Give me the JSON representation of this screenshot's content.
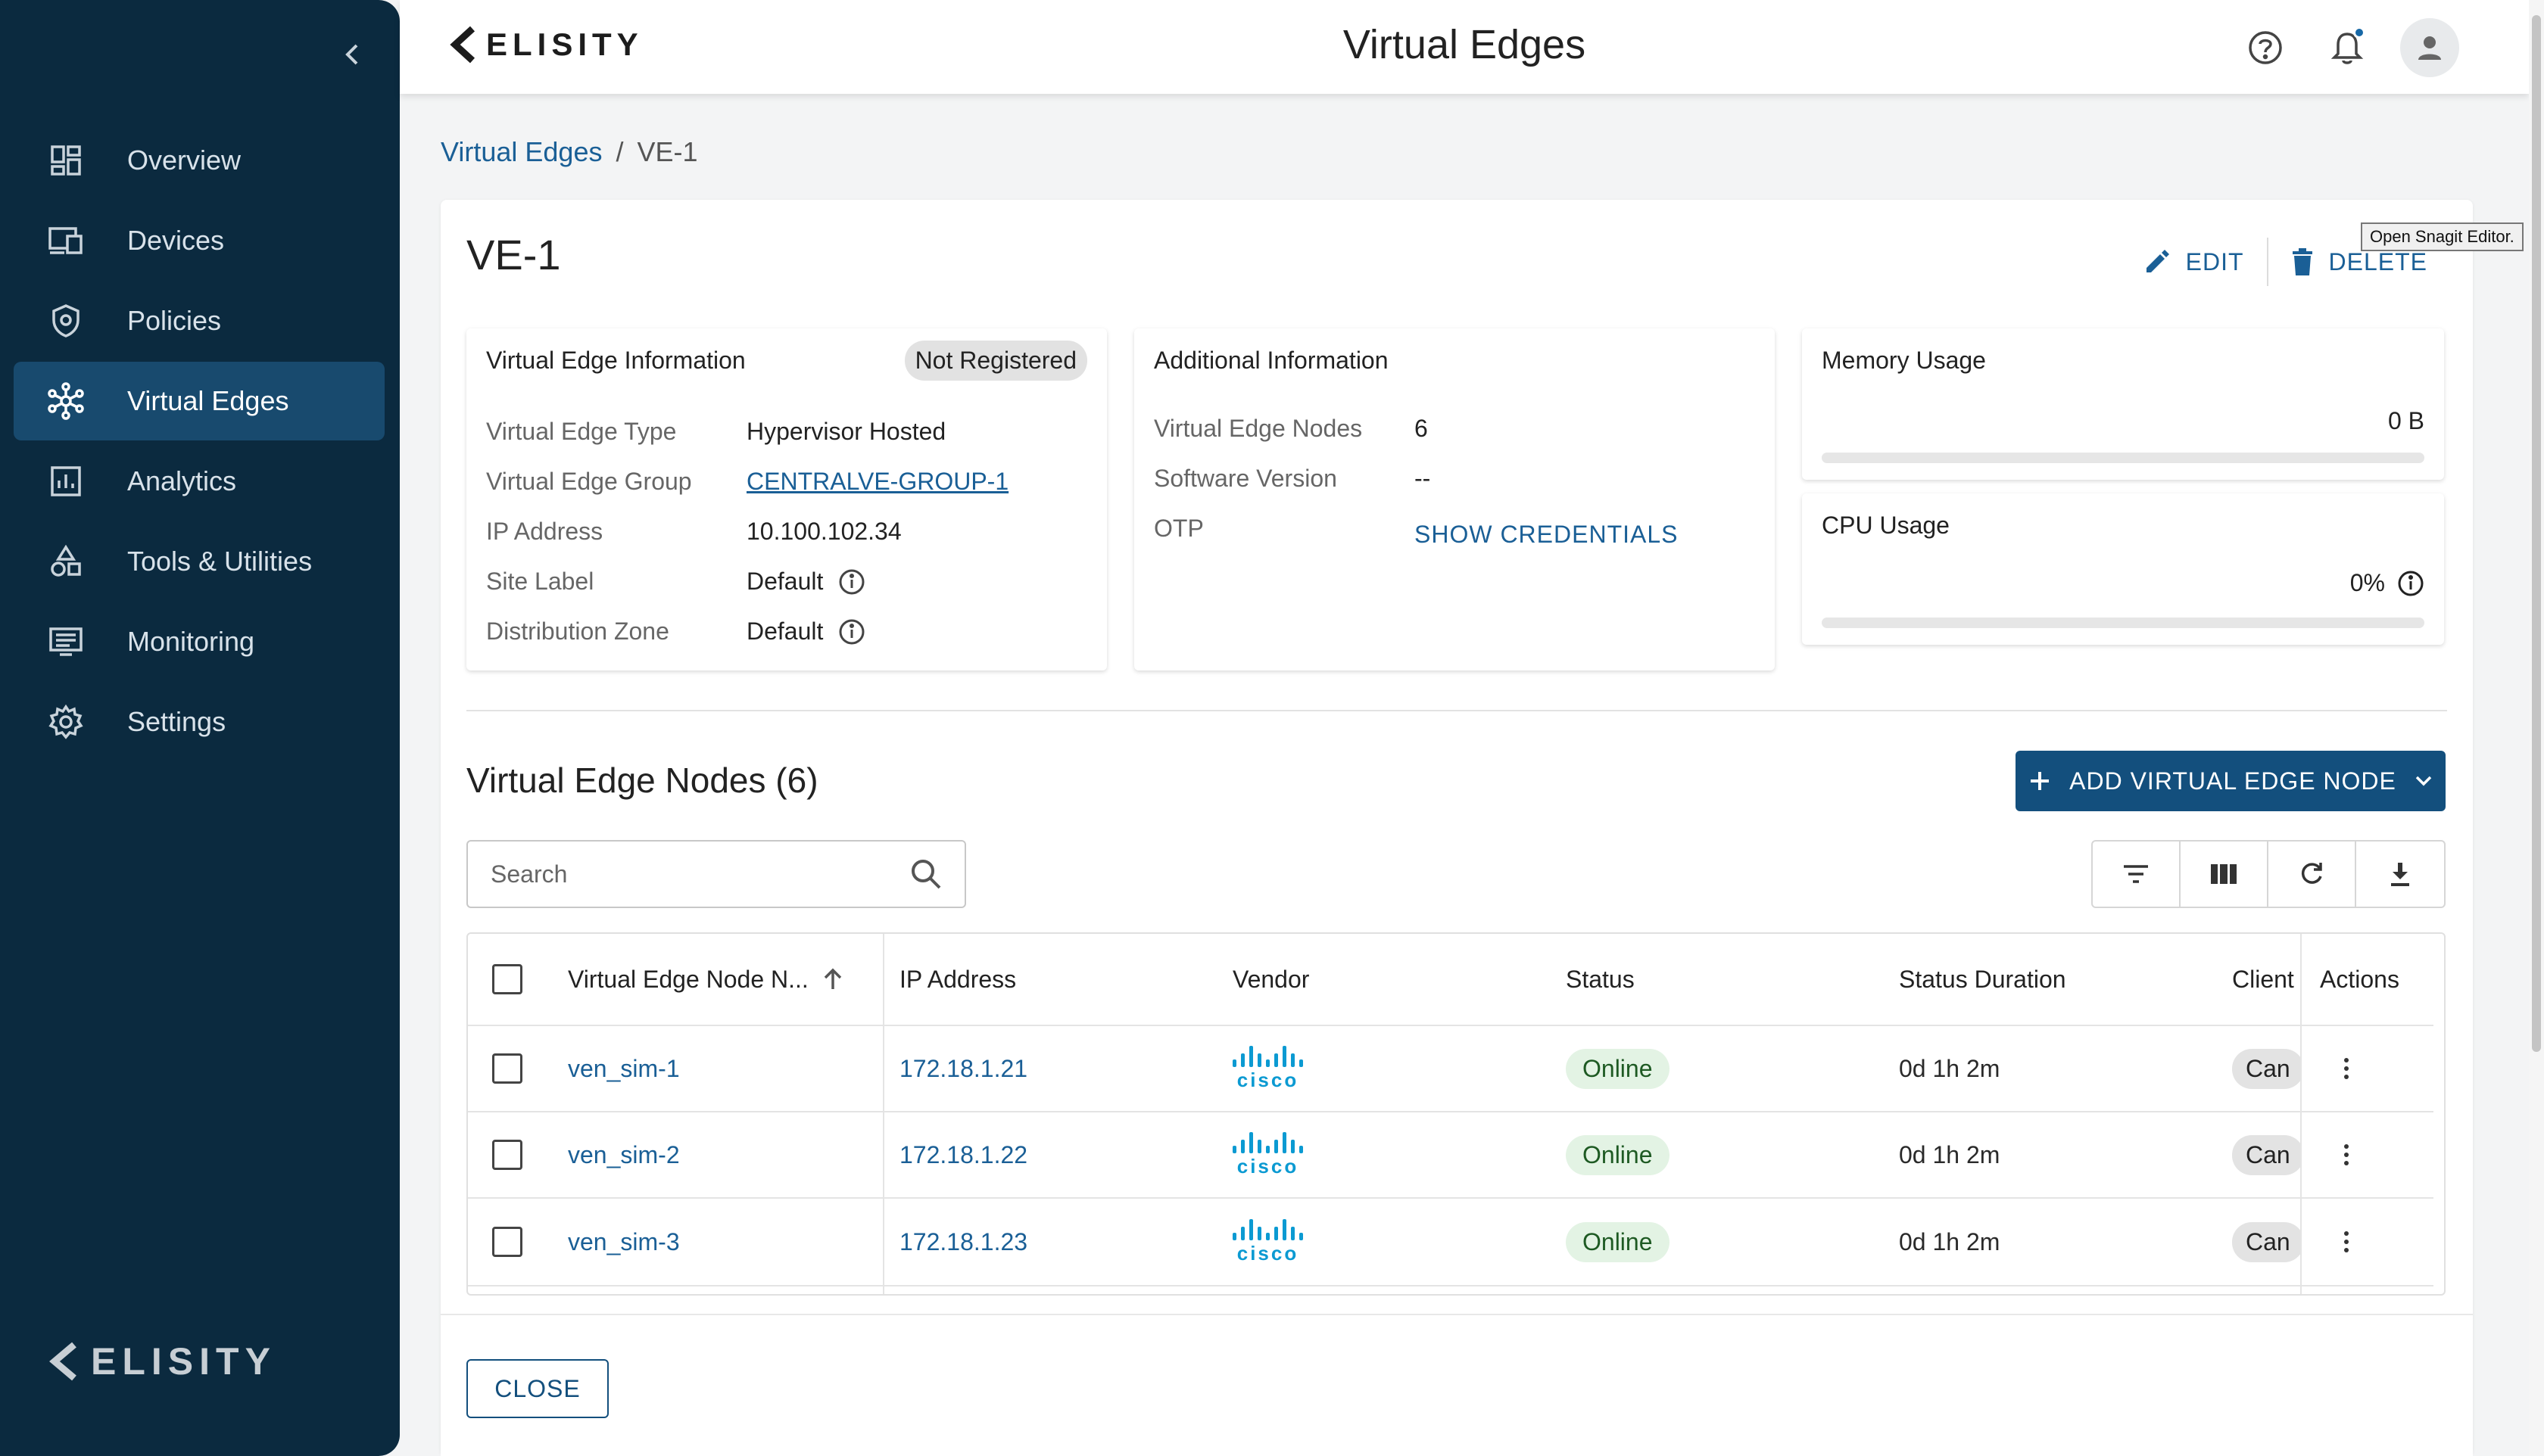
{
  "sidebar": {
    "items": [
      {
        "label": "Overview",
        "icon": "dashboard-icon"
      },
      {
        "label": "Devices",
        "icon": "devices-icon"
      },
      {
        "label": "Policies",
        "icon": "shield-icon"
      },
      {
        "label": "Virtual Edges",
        "icon": "network-icon"
      },
      {
        "label": "Analytics",
        "icon": "analytics-icon"
      },
      {
        "label": "Tools & Utilities",
        "icon": "tools-icon"
      },
      {
        "label": "Monitoring",
        "icon": "monitor-icon"
      },
      {
        "label": "Settings",
        "icon": "gear-icon"
      }
    ],
    "active": "Virtual Edges",
    "logo": "ELISITY"
  },
  "header": {
    "logo": "ELISITY",
    "title": "Virtual Edges"
  },
  "breadcrumb": {
    "parent": "Virtual Edges",
    "separator": "/",
    "current": "VE-1"
  },
  "card": {
    "title": "VE-1",
    "edit_label": "EDIT",
    "delete_label": "DELETE",
    "tooltip": "Open Snagit Editor."
  },
  "ve_info": {
    "title": "Virtual Edge Information",
    "status": "Not Registered",
    "rows": [
      {
        "label": "Virtual Edge Type",
        "value": "Hypervisor Hosted"
      },
      {
        "label": "Virtual Edge Group",
        "value": "CENTRALVE-GROUP-1"
      },
      {
        "label": "IP Address",
        "value": "10.100.102.34"
      },
      {
        "label": "Site Label",
        "value": "Default"
      },
      {
        "label": "Distribution Zone",
        "value": "Default"
      }
    ]
  },
  "additional_info": {
    "title": "Additional Information",
    "rows": [
      {
        "label": "Virtual Edge Nodes",
        "value": "6"
      },
      {
        "label": "Software Version",
        "value": "--"
      },
      {
        "label": "OTP",
        "value": "SHOW CREDENTIALS"
      }
    ]
  },
  "memory": {
    "title": "Memory Usage",
    "value": "0 B"
  },
  "cpu": {
    "title": "CPU Usage",
    "value": "0%"
  },
  "nodes": {
    "title": "Virtual Edge Nodes (6)",
    "add_label": "ADD VIRTUAL EDGE NODE",
    "search_placeholder": "Search",
    "columns": {
      "name": "Virtual Edge Node N...",
      "ip": "IP Address",
      "vendor": "Vendor",
      "status": "Status",
      "duration": "Status Duration",
      "client": "Client",
      "actions": "Actions"
    },
    "rows": [
      {
        "name": "ven_sim-1",
        "ip": "172.18.1.21",
        "vendor": "cisco",
        "status": "Online",
        "duration": "0d 1h 2m",
        "client": "Can"
      },
      {
        "name": "ven_sim-2",
        "ip": "172.18.1.22",
        "vendor": "cisco",
        "status": "Online",
        "duration": "0d 1h 2m",
        "client": "Can"
      },
      {
        "name": "ven_sim-3",
        "ip": "172.18.1.23",
        "vendor": "cisco",
        "status": "Online",
        "duration": "0d 1h 2m",
        "client": "Can"
      }
    ]
  },
  "footer": {
    "close_label": "CLOSE"
  },
  "colors": {
    "sidebar": "#0b2a3f",
    "active_nav": "#184a6e",
    "accent": "#134f7d",
    "link": "#1a5f96",
    "online": "#e3f3e4"
  }
}
